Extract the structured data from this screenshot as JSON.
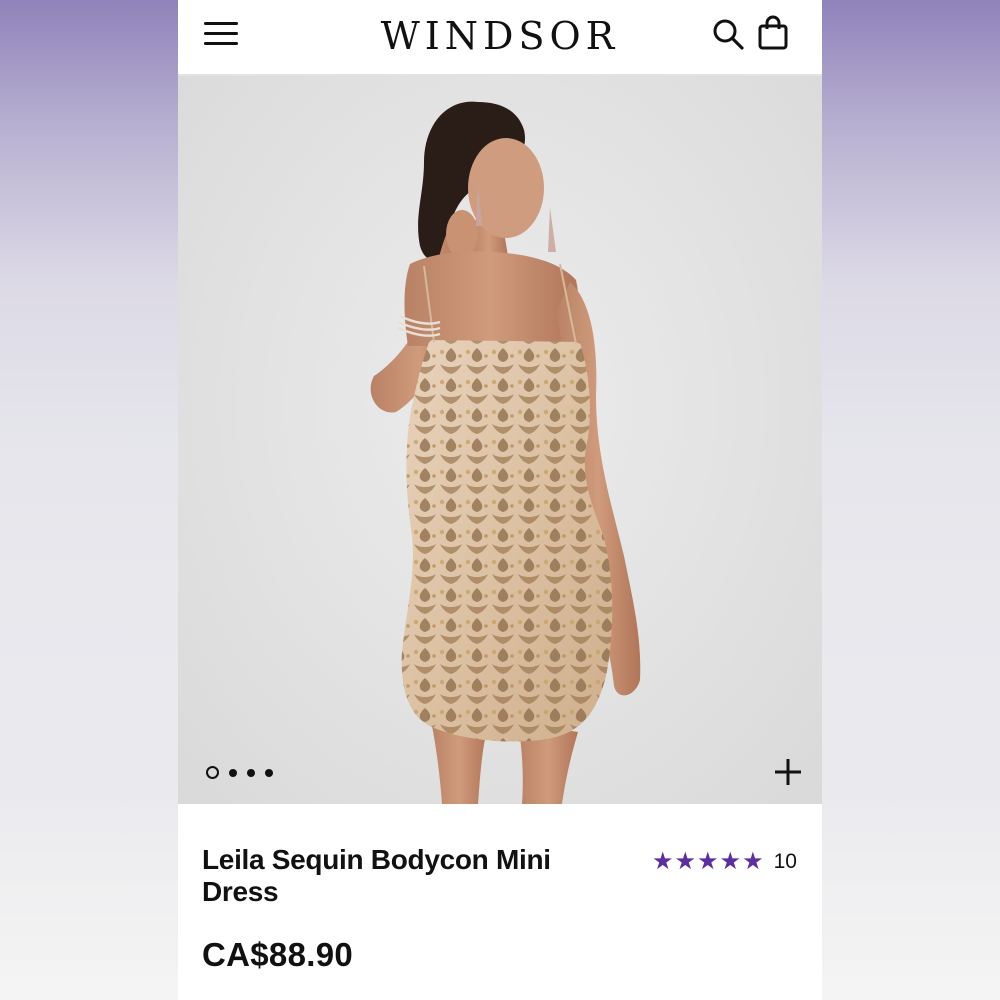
{
  "header": {
    "brand": "WINDSOR",
    "menu_icon": "hamburger-menu-icon",
    "search_icon": "search-icon",
    "bag_icon": "shopping-bag-icon"
  },
  "gallery": {
    "image_count": 4,
    "active_index": 0,
    "zoom_icon": "plus-icon"
  },
  "product": {
    "title": "Leila Sequin Bodycon Mini Dress",
    "rating": 5,
    "review_count": "10",
    "price": "CA$88.90"
  },
  "colors": {
    "star": "#5d2f9e",
    "text": "#111111"
  }
}
